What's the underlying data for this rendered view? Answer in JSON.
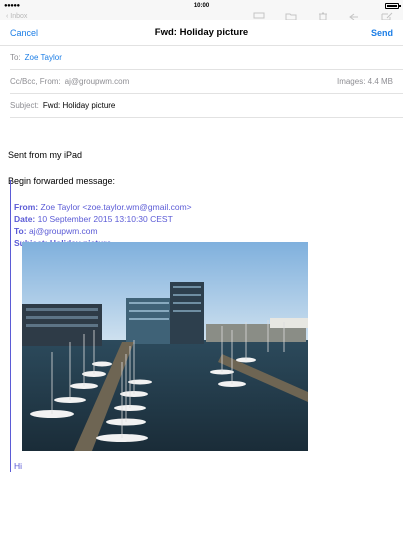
{
  "status_bar": {
    "signal": "●●●●●",
    "time": "10:00",
    "battery_level": 1.0
  },
  "background_toolbar": {
    "back_label": "Inbox"
  },
  "compose": {
    "cancel_label": "Cancel",
    "title": "Fwd: Holiday picture",
    "send_label": "Send",
    "to_label": "To:",
    "to_value": "Zoe Taylor",
    "cc_label": "Cc/Bcc, From:",
    "cc_value": "aj@groupwm.com",
    "images_label": "Images: 4.4 MB",
    "subject_label": "Subject:",
    "subject_value": "Fwd: Holiday picture"
  },
  "body": {
    "signature": "Sent from my iPad",
    "forward_header": "Begin forwarded message:",
    "from_label": "From:",
    "from_value": "Zoe Taylor <zoe.taylor.wm@gmail.com>",
    "date_label": "Date:",
    "date_value": "10 September 2015 13:10:30 CEST",
    "to_label": "To:",
    "to_value": "aj@groupwm.com",
    "subject_label": "Subject:",
    "subject_value": "Holiday picture",
    "trailing_text": "Hi"
  },
  "colors": {
    "accent": "#1c7ee6",
    "quote": "#5b5bd6",
    "muted": "#8e8e93"
  }
}
